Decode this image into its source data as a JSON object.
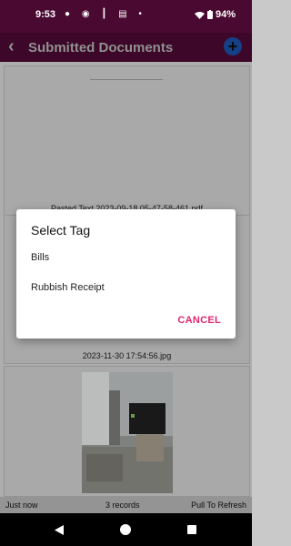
{
  "status_bar": {
    "time": "9:53",
    "notification_icons": "● ◉ ┃ ▤ •",
    "battery": "94%"
  },
  "toolbar": {
    "title": "Submitted Documents",
    "back_icon": "chevron-left-icon",
    "add_icon": "plus-circle-icon"
  },
  "documents": [
    {
      "caption": "Pasted Text 2023-09-18 05-47-58-461.pdf"
    },
    {
      "caption": "2023-11-30 17:54:56.jpg"
    },
    {
      "caption": ""
    }
  ],
  "bottom_bar": {
    "left": "Just now",
    "center": "3 records",
    "right": "Pull To Refresh"
  },
  "dialog": {
    "title": "Select Tag",
    "options": [
      "Bills",
      "Rubbish Receipt"
    ],
    "cancel_label": "CANCEL"
  },
  "colors": {
    "app_bar": "#4a0931",
    "accent": "#e0266e",
    "fab": "#1b4fa4"
  }
}
